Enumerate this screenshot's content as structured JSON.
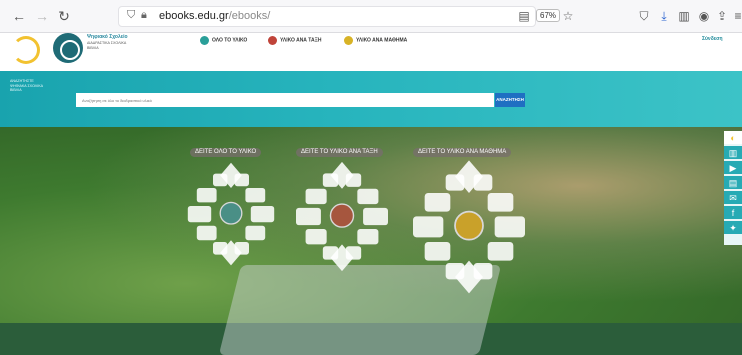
{
  "browser": {
    "url_host": "ebooks.edu.gr",
    "url_path": "/ebooks/",
    "zoom": "67%"
  },
  "site": {
    "brand_title": "Ψηφιακό Σχολείο",
    "brand_sub": "ΔΙΑΔΡΑΣΤΙΚΑ ΣΧΟΛΙΚΑ ΒΙΒΛΙΑ",
    "nav": [
      {
        "label": "ΟΛΟ ΤΟ ΥΛΙΚΟ",
        "color": "#2a9f99"
      },
      {
        "label": "ΥΛΙΚΟ ΑΝΑ ΤΑΞΗ",
        "color": "#c0443a"
      },
      {
        "label": "ΥΛΙΚΟ ΑΝΑ ΜΑΘΗΜΑ",
        "color": "#d8b326"
      }
    ],
    "login": "Σύνδεση"
  },
  "search": {
    "side_note": "ΑΝΑΖΗΤΗΣΤΕ ΨΗΦΙΑΚΑ ΣΧΟΛΙΚΑ ΒΙΒΛΙΑ",
    "placeholder": "Αναζήτηση σε όλο το διαδραστικό υλικό",
    "button": "ΑΝΑΖΗΤΗΣΗ"
  },
  "hero": {
    "labels": [
      "ΔΕΙΤΕ ΟΛΟ ΤΟ ΥΛΙΚΟ",
      "ΔΕΙΤΕ ΤΟ ΥΛΙΚΟ ΑΝΑ ΤΑΞΗ",
      "ΔΕΙΤΕ ΤΟ ΥΛΙΚΟ ΑΝΑ ΜΑΘΗΜΑ"
    ],
    "center_colors": [
      "#4a8f86",
      "#a6563e",
      "#c9a12a"
    ]
  },
  "share": {
    "icons": [
      "logo-icon",
      "book-icon",
      "video-icon",
      "document-icon",
      "mail-icon",
      "facebook-icon",
      "twitter-icon"
    ]
  }
}
